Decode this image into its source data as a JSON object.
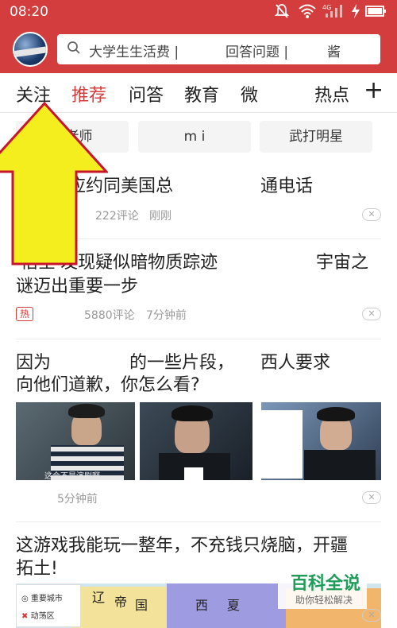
{
  "status_bar": {
    "time": "08:20",
    "icons": [
      "mute-icon",
      "wifi-icon",
      "signal-icon",
      "charging-icon",
      "battery-icon"
    ],
    "network_label": "4G"
  },
  "header": {
    "search_text_1": "大学生生活费 | ",
    "search_text_2": "回答问题 |",
    "search_text_3": "酱",
    "accent_color": "#d43d3d"
  },
  "tabs": [
    {
      "label": "关注"
    },
    {
      "label": "推荐"
    },
    {
      "label": "问答"
    },
    {
      "label": "教育"
    },
    {
      "label": "微"
    },
    {
      "label": "热点"
    }
  ],
  "tab_add_label": "+",
  "chips": [
    {
      "label": "园老师"
    },
    {
      "label": "m        i"
    },
    {
      "label": "武打明星"
    }
  ],
  "feed": [
    {
      "title_part1": "应约同美国总",
      "title_part2": "通电话",
      "comments": "222评论",
      "time": "刚刚"
    },
    {
      "title_part1": "'悟空'发现疑似暗物质踪迹",
      "title_part2": "宇宙之",
      "title_line2": "谜迈出重要一步",
      "badge": "热",
      "comments": "5880评论",
      "time": "7分钟前"
    },
    {
      "title_part1": "因为",
      "title_part2": "的一些片段，",
      "title_part3": "西人要求",
      "title_line2": "向他们道歉，你怎么看?",
      "thumb_caption": "这会不是演剧啊",
      "time": "5分钟前"
    },
    {
      "title_line1": "这游戏我能玩一整年，不充钱只烧脑，开疆",
      "title_line2": "拓土!",
      "map_text": [
        "辽",
        "帝",
        "国",
        "西",
        "夏"
      ],
      "legend": [
        "重要城市",
        "动荡区"
      ]
    }
  ],
  "dismiss_label": "✕",
  "watermark": {
    "title": "百科全说",
    "subtitle": "助你轻松解决"
  },
  "arrow_color": "#f5ee1e"
}
